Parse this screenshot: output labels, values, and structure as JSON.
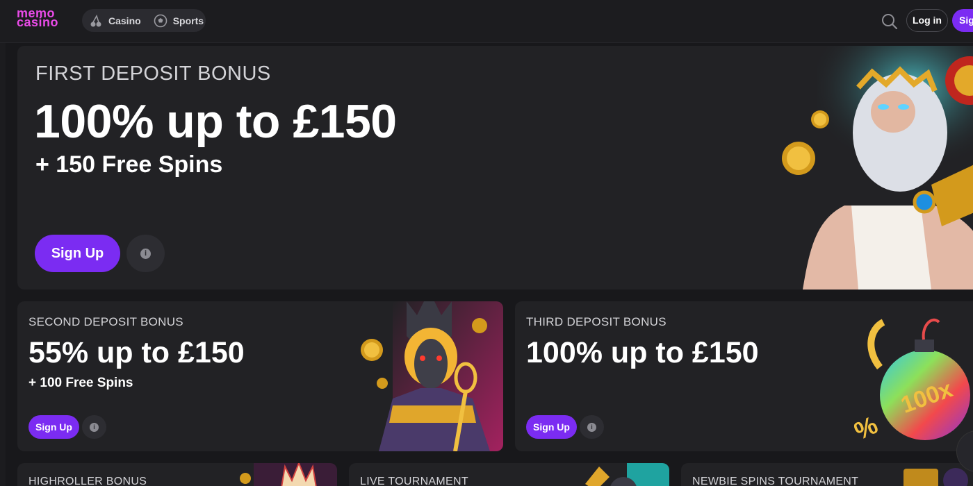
{
  "header": {
    "logo_line1": "memo",
    "logo_line2": "casino",
    "nav": [
      {
        "label": "Casino",
        "icon": "cherries-icon"
      },
      {
        "label": "Sports",
        "icon": "football-icon"
      }
    ],
    "login_label": "Log in",
    "signup_label": "Sign Up"
  },
  "hero": {
    "subtitle": "FIRST DEPOSIT BONUS",
    "title": "100% up to £150",
    "extra": "+ 150 Free Spins",
    "cta": "Sign Up",
    "info_glyph": "i"
  },
  "cards": [
    {
      "subtitle": "SECOND DEPOSIT BONUS",
      "title": "55% up to £150",
      "extra": "+ 100 Free Spins",
      "cta": "Sign Up",
      "info_glyph": "i"
    },
    {
      "subtitle": "THIRD DEPOSIT BONUS",
      "title": "100% up to £150",
      "cta": "Sign Up",
      "info_glyph": "i"
    }
  ],
  "bottom_cards": [
    {
      "subtitle": "HIGHROLLER BONUS"
    },
    {
      "subtitle": "LIVE TOURNAMENT"
    },
    {
      "subtitle": "NEWBIE SPINS TOURNAMENT"
    }
  ],
  "colors": {
    "accent": "#7b2cf2",
    "logo": "#ea4be8",
    "background": "#18181b",
    "card": "#222225"
  }
}
